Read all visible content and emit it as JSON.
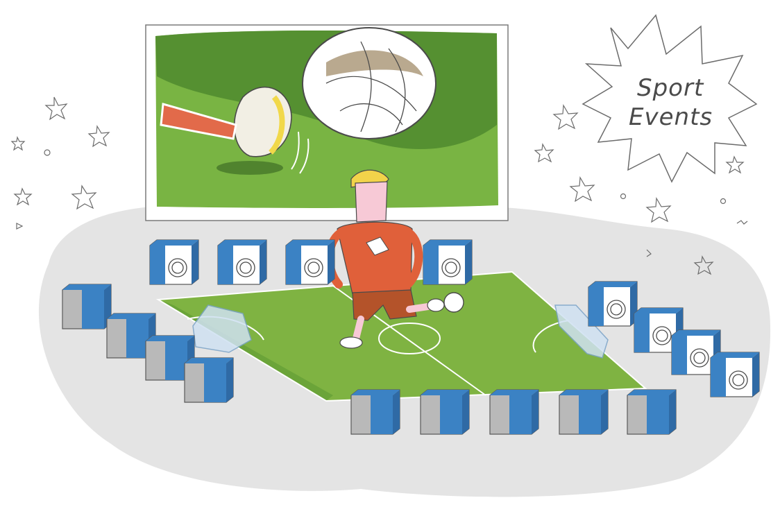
{
  "illustration": {
    "title_lines": [
      "Sport",
      "Events"
    ],
    "colors": {
      "background": "#ffffff",
      "shadow": "#e3e3e3",
      "field": "#7fb342",
      "field_dark": "#5e9a34",
      "screen_grass": "#6aa53c",
      "screen_grass_dark": "#4f8a2e",
      "camera_blue": "#3b82c4",
      "camera_gray": "#b9b9b9",
      "shirt": "#e0603a",
      "shorts": "#b4532a",
      "hair": "#f2d34a",
      "skin": "#f7c9d6",
      "outline": "#4a4a4a"
    },
    "icons": [
      "large-screen-icon",
      "kick-closeup-icon",
      "football-player-icon",
      "soccer-field-icon",
      "camera-icon",
      "starburst-badge-icon",
      "star-doodle-icon"
    ]
  }
}
